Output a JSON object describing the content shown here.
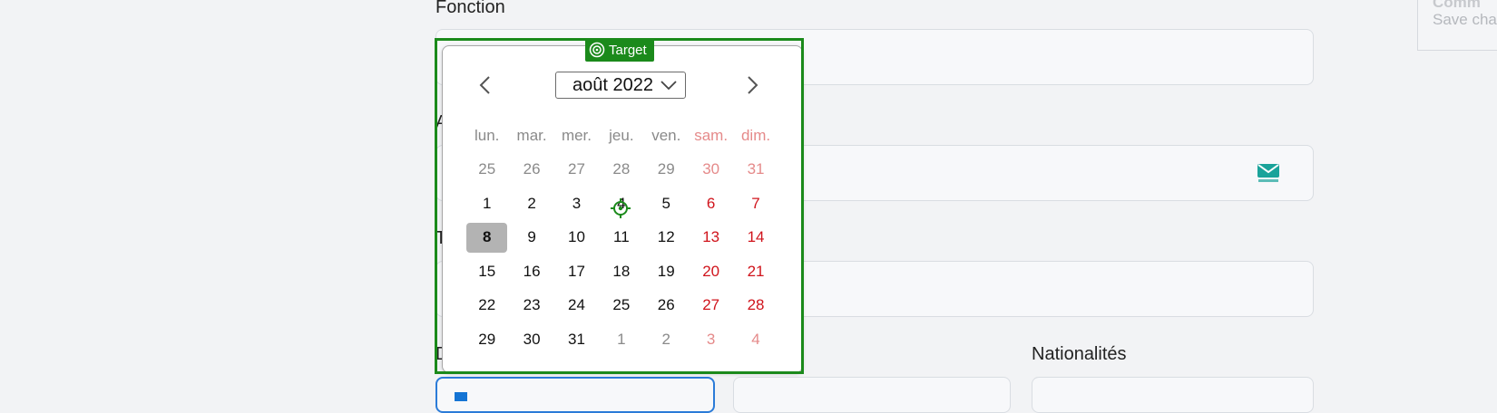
{
  "form": {
    "fonction_label": "Fonction",
    "nationalites_label": "Nationalités"
  },
  "corner_card": {
    "title": "Comm",
    "subtitle": "Save cha"
  },
  "datepicker": {
    "month_label": "août 2022",
    "prev_icon": "chevron-left-icon",
    "next_icon": "chevron-right-icon",
    "weekdays": [
      "lun.",
      "mar.",
      "mer.",
      "jeu.",
      "ven.",
      "sam.",
      "dim."
    ],
    "weeks": [
      [
        "25",
        "26",
        "27",
        "28",
        "29",
        "30",
        "31"
      ],
      [
        "1",
        "2",
        "3",
        "4",
        "5",
        "6",
        "7"
      ],
      [
        "8",
        "9",
        "10",
        "11",
        "12",
        "13",
        "14"
      ],
      [
        "15",
        "16",
        "17",
        "18",
        "19",
        "20",
        "21"
      ],
      [
        "22",
        "23",
        "24",
        "25",
        "26",
        "27",
        "28"
      ],
      [
        "29",
        "30",
        "31",
        "1",
        "2",
        "3",
        "4"
      ]
    ],
    "selected_day": "8",
    "weekend_color": "#d0141c",
    "selected_bg": "#b3b3b3"
  },
  "annotation": {
    "label": "Target",
    "color": "#1b8a1b"
  }
}
